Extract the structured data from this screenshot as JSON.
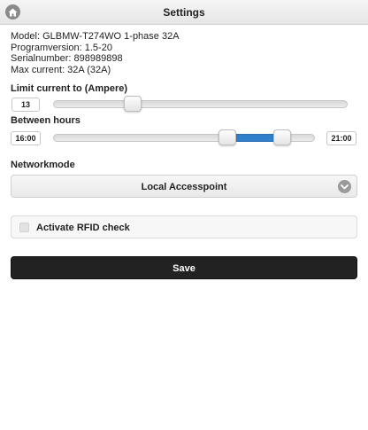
{
  "header": {
    "title": "Settings",
    "home_icon": "home-icon"
  },
  "info": {
    "model": "Model: GLBMW-T274WO 1-phase 32A",
    "program_version": "Programversion: 1.5-20",
    "serial_number": "Serialnumber: 898989898",
    "max_current": "Max current: 32A (32A)"
  },
  "limit_current": {
    "label": "Limit current to (Ampere)",
    "value": "13",
    "slider_fraction": 0.27
  },
  "between_hours": {
    "label": "Between hours",
    "start_value": "16:00",
    "end_value": "21:00",
    "start_fraction": 0.667,
    "end_fraction": 0.875
  },
  "network_mode": {
    "label": "Networkmode",
    "selected": "Local Accesspoint",
    "icon": "chevron-down-icon"
  },
  "rfid": {
    "label": "Activate RFID check",
    "checked": false
  },
  "save": {
    "label": "Save"
  },
  "colors": {
    "accent": "#2f7fca",
    "button": "#222222"
  }
}
